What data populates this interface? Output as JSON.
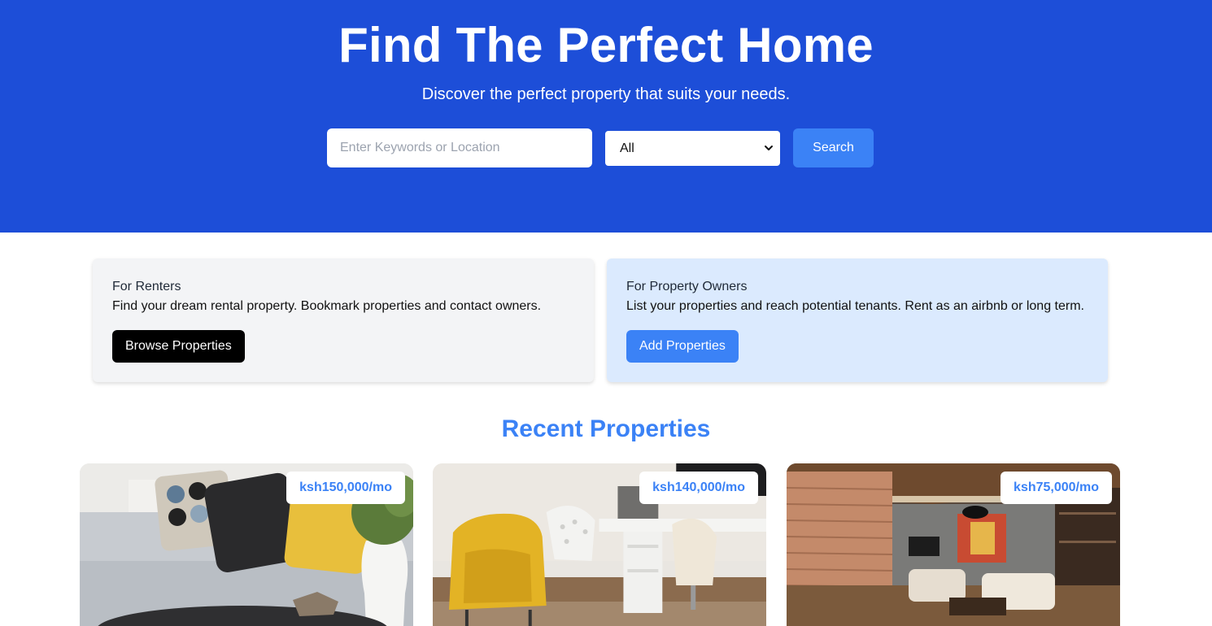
{
  "hero": {
    "title": "Find The Perfect Home",
    "subtitle": "Discover the perfect property that suits your needs."
  },
  "search": {
    "placeholder": "Enter Keywords or Location",
    "value": "",
    "type_selected": "All",
    "button_label": "Search"
  },
  "renters": {
    "title": "For Renters",
    "description": "Find your dream rental property. Bookmark properties and contact owners.",
    "button_label": "Browse Properties"
  },
  "owners": {
    "title": "For Property Owners",
    "description": "List your properties and reach potential tenants. Rent as an airbnb or long term.",
    "button_label": "Add Properties"
  },
  "recent": {
    "title": "Recent Properties",
    "properties": [
      {
        "price": "ksh150,000/mo",
        "image": "living-room-sofa-cushions"
      },
      {
        "price": "ksh140,000/mo",
        "image": "home-office-yellow-chair"
      },
      {
        "price": "ksh75,000/mo",
        "image": "lounge-with-blinds"
      }
    ]
  },
  "colors": {
    "hero_bg": "#1d4ed8",
    "accent": "#3b82f6",
    "renters_bg": "#f3f4f6",
    "owners_bg": "#dbeafe"
  }
}
